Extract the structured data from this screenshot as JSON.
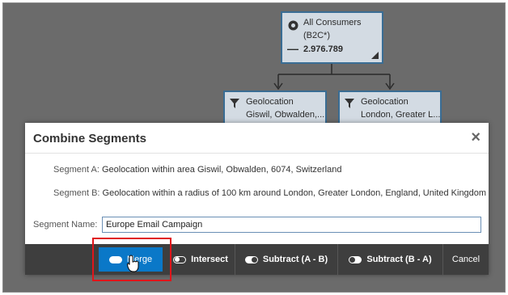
{
  "tree": {
    "root": {
      "title": "All Consumers",
      "subtitle": "(B2C*)",
      "count": "2.976.789"
    },
    "node_a": {
      "title": "Geolocation",
      "subtitle": "Giswil, Obwalden,..."
    },
    "node_b": {
      "title": "Geolocation",
      "subtitle": "London, Greater L..."
    }
  },
  "dialog": {
    "title": "Combine Segments",
    "segment_a_label": "Segment A:",
    "segment_a_value": "Geolocation within area Giswil, Obwalden, 6074, Switzerland",
    "segment_b_label": "Segment B:",
    "segment_b_value": "Geolocation within a radius of 100 km around London, Greater London, England, United Kingdom",
    "name_label": "Segment Name:",
    "name_value": "Europe Email Campaign",
    "close_icon": "×"
  },
  "footer": {
    "merge": "Merge",
    "intersect": "Intersect",
    "subtract_ab": "Subtract (A - B)",
    "subtract_ba": "Subtract (B - A)",
    "cancel": "Cancel"
  },
  "colors": {
    "accent": "#0a78c8",
    "highlight": "#e0151a",
    "footer": "#3e3e3e"
  }
}
